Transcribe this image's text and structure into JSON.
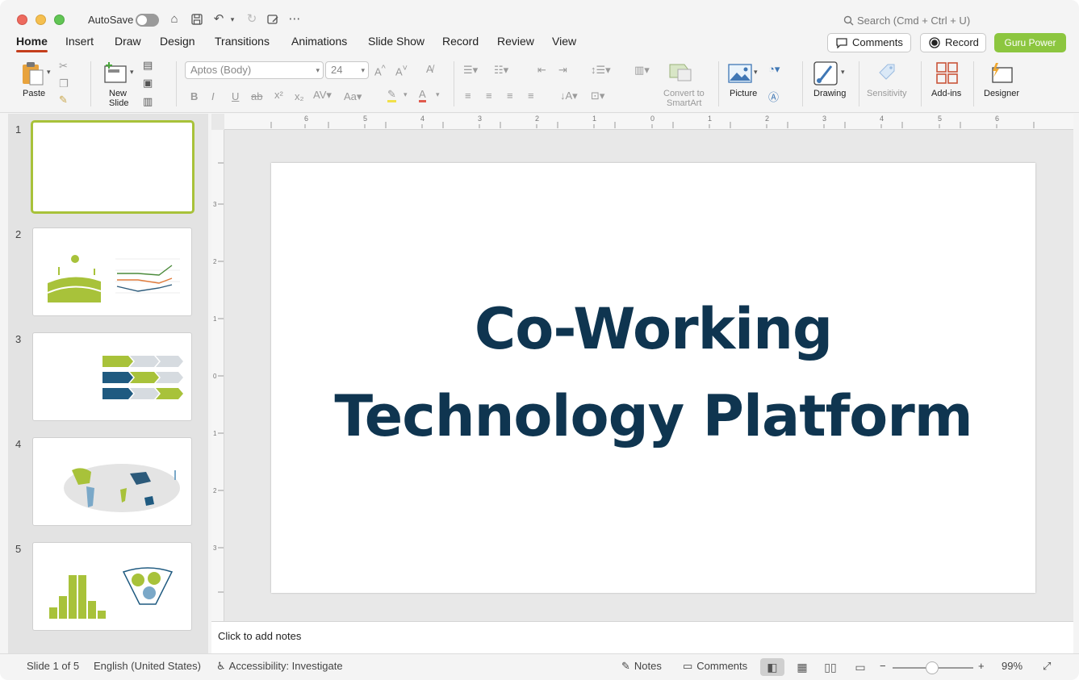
{
  "titlebar": {
    "autosave_label": "AutoSave",
    "search_placeholder": "Search (Cmd + Ctrl + U)"
  },
  "tabs": [
    {
      "label": "Home",
      "active": true
    },
    {
      "label": "Insert"
    },
    {
      "label": "Draw"
    },
    {
      "label": "Design"
    },
    {
      "label": "Transitions"
    },
    {
      "label": "Animations"
    },
    {
      "label": "Slide Show"
    },
    {
      "label": "Record"
    },
    {
      "label": "Review"
    },
    {
      "label": "View"
    }
  ],
  "header_buttons": {
    "comments": "Comments",
    "record": "Record",
    "guru": "Guru Power"
  },
  "ribbon": {
    "paste": "Paste",
    "new_slide_line1": "New",
    "new_slide_line2": "Slide",
    "font_name": "Aptos (Body)",
    "font_size": "24",
    "convert_line1": "Convert to",
    "convert_line2": "SmartArt",
    "picture": "Picture",
    "drawing": "Drawing",
    "sensitivity": "Sensitivity",
    "addins": "Add-ins",
    "designer": "Designer"
  },
  "colors": {
    "accent_green": "#8cc63f",
    "title_navy": "#0f3550",
    "tab_underline": "#c43e1c"
  },
  "thumbnails": [
    "1",
    "2",
    "3",
    "4",
    "5"
  ],
  "slide": {
    "title_line1": "Co-Working",
    "title_line2": "Technology Platform"
  },
  "notes": {
    "placeholder": "Click to add notes"
  },
  "status": {
    "slide_count": "Slide 1 of 5",
    "language": "English (United States)",
    "accessibility": "Accessibility: Investigate",
    "notes": "Notes",
    "comments": "Comments",
    "zoom": "99%"
  }
}
